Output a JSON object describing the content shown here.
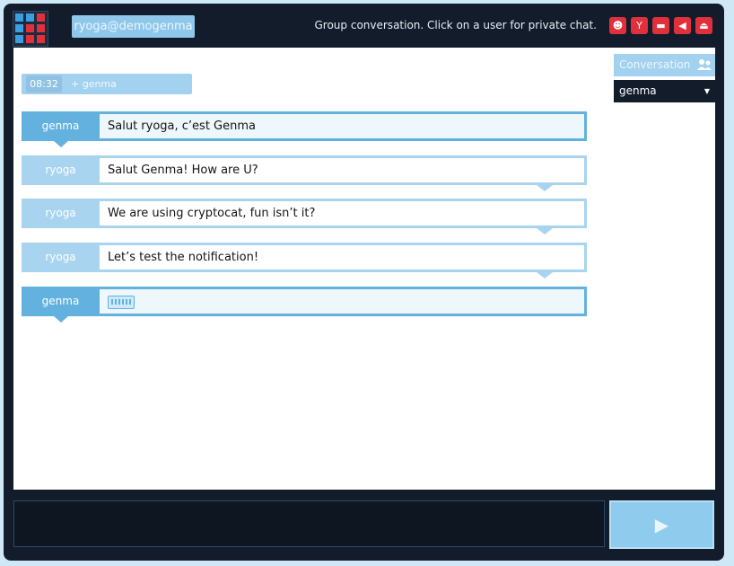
{
  "header": {
    "nickname": "ryoga@demogenma",
    "status": "Group conversation. Click on a user for private chat.",
    "icons": [
      "avatar-icon",
      "filter-icon",
      "notification-icon",
      "sound-icon",
      "logout-icon"
    ]
  },
  "chat": {
    "join_time": "08:32",
    "join_text": "+ genma",
    "messages": [
      {
        "user": "genma",
        "text": "Salut ryoga, c’est Genma"
      },
      {
        "user": "ryoga",
        "text": "Salut Genma! How are U?"
      },
      {
        "user": "ryoga",
        "text": "We are using cryptocat, fun isn’t it?"
      },
      {
        "user": "ryoga",
        "text": "Let’s test the notification!"
      },
      {
        "user": "genma",
        "text": ""
      }
    ]
  },
  "sidebar": {
    "conversation_label": "Conversation",
    "users": [
      "genma"
    ]
  },
  "composer": {
    "input_value": "",
    "send_glyph": "▶"
  },
  "colors": {
    "frame": "#121c2a",
    "accent": "#63b1df",
    "light_accent": "#a9d4ef",
    "alert": "#e0303c"
  }
}
